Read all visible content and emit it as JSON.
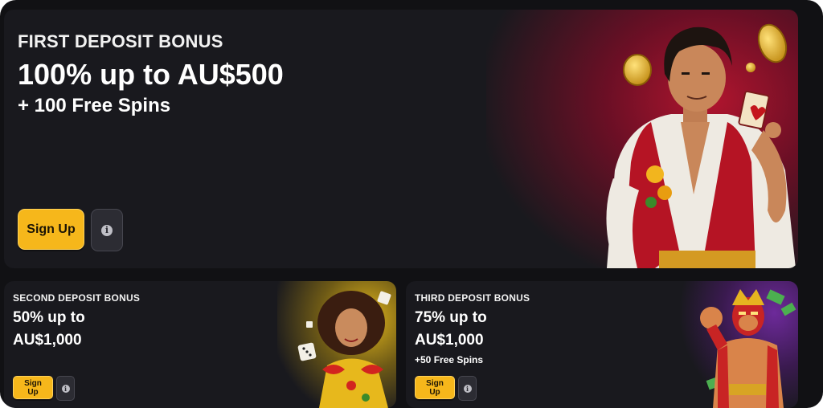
{
  "cards": {
    "first": {
      "kicker": "FIRST DEPOSIT BONUS",
      "headline": "100% up to AU$500",
      "sub": "+ 100 Free Spins",
      "signup_label": "Sign Up",
      "info_icon": "info-icon"
    },
    "second": {
      "kicker": "SECOND DEPOSIT BONUS",
      "headline_line1": "50% up to",
      "headline_line2": "AU$1,000",
      "signup_label": "Sign Up",
      "info_icon": "info-icon"
    },
    "third": {
      "kicker": "THIRD DEPOSIT BONUS",
      "headline_line1": "75% up to",
      "headline_line2": "AU$1,000",
      "sub": "+50 Free Spins",
      "signup_label": "Sign Up",
      "info_icon": "info-icon"
    }
  },
  "colors": {
    "background": "#111114",
    "card": "#19191e",
    "accent_button": "#f6b71b",
    "info_button": "#2c2c33",
    "hero_glow": "#a0142c"
  }
}
